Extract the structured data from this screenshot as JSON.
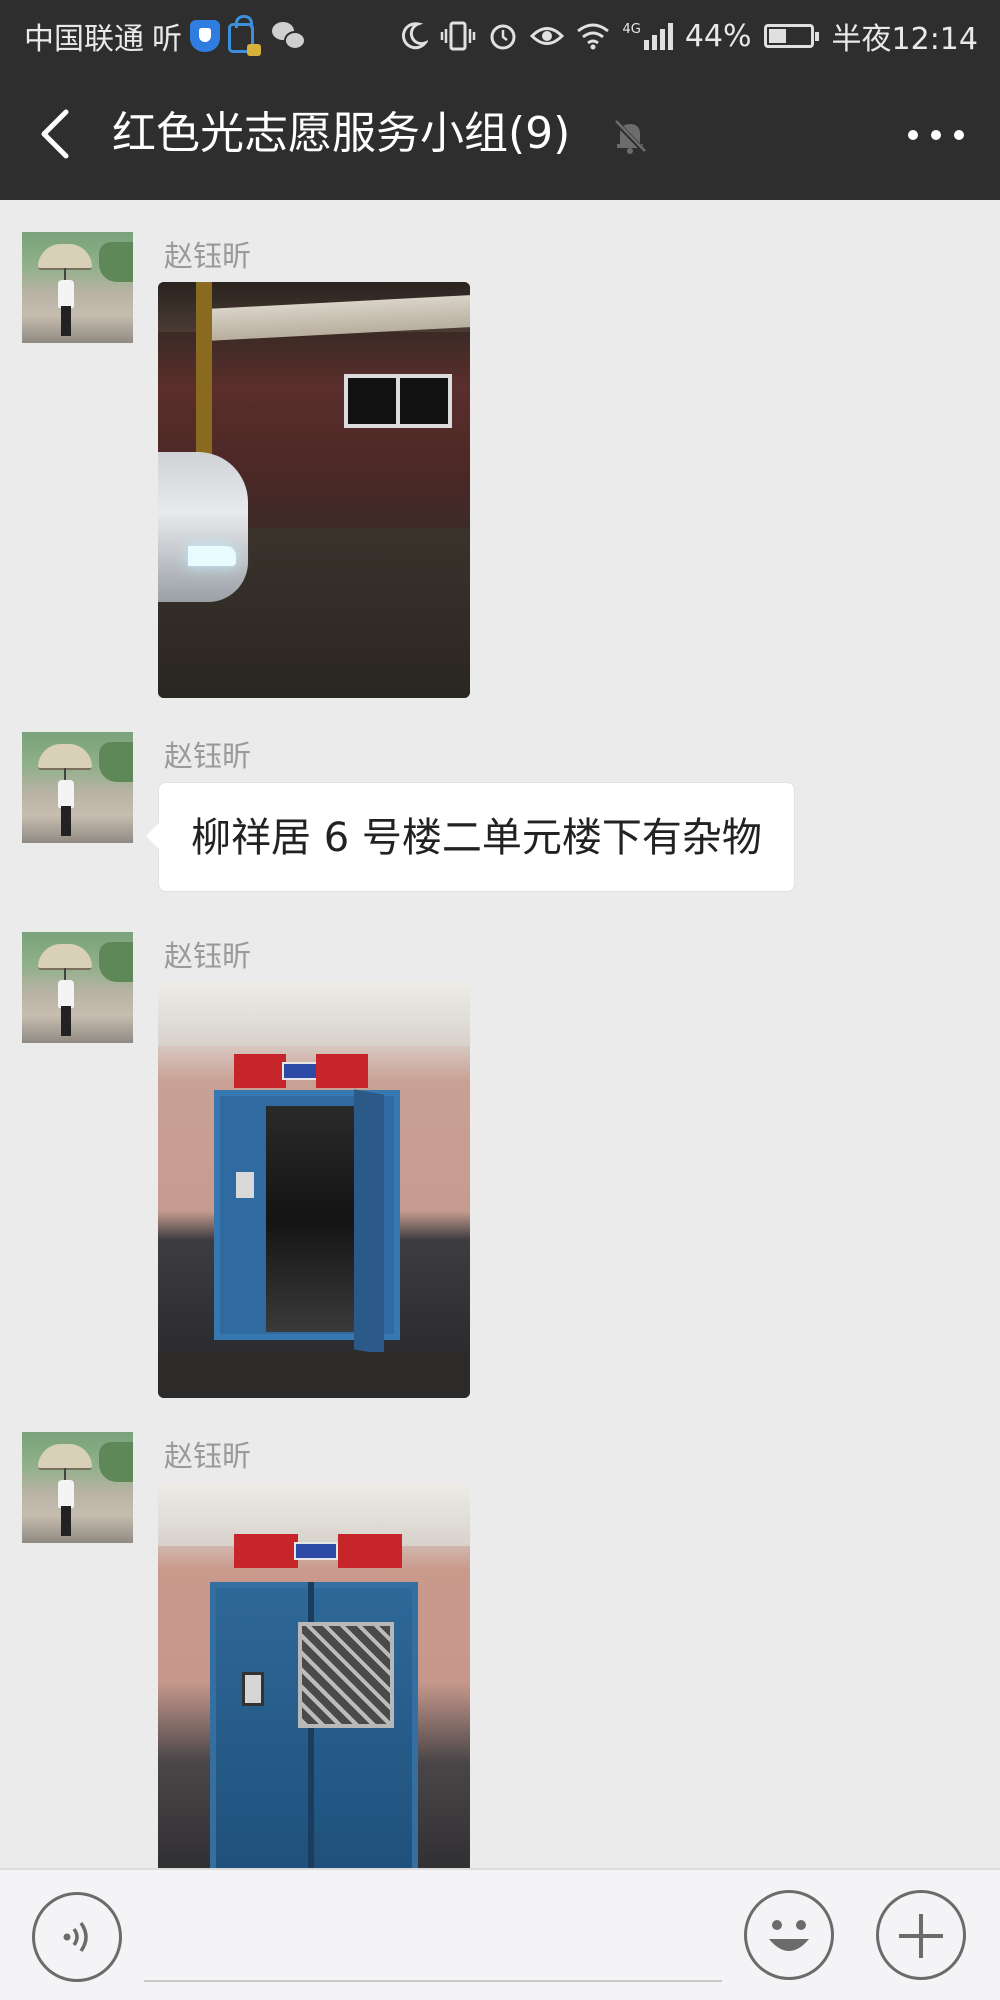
{
  "status_bar": {
    "carrier": "中国联通",
    "carrier_extra": "听",
    "network": "4G",
    "battery_percent": "44%",
    "battery_level": 0.44,
    "time": "半夜12:14",
    "icons": [
      "shield-icon",
      "bag-icon",
      "wechat-icon",
      "moon-icon",
      "vibrate-icon",
      "alarm-icon",
      "eye-icon",
      "wifi-icon",
      "signal-icon",
      "battery-icon"
    ]
  },
  "header": {
    "back_icon": "chevron-left-icon",
    "title": "红色光志愿服务小组(9)",
    "mute_icon": "bell-off-icon",
    "more_icon": "more-horizontal-icon"
  },
  "messages": [
    {
      "type": "image",
      "sender": "赵钰昕",
      "image": "photo-building-entrance-night"
    },
    {
      "type": "text",
      "sender": "赵钰昕",
      "text": "柳祥居 6 号楼二单元楼下有杂物"
    },
    {
      "type": "image",
      "sender": "赵钰昕",
      "image": "photo-open-blue-door"
    },
    {
      "type": "image",
      "sender": "赵钰昕",
      "image": "photo-closed-blue-door"
    }
  ],
  "input_bar": {
    "voice_icon": "voice-icon",
    "input_value": "",
    "emoji_icon": "smiley-icon",
    "plus_icon": "plus-icon"
  },
  "colors": {
    "header_bg": "#2e2e2e",
    "chat_bg": "#ebebeb",
    "bubble_bg": "#ffffff",
    "sender_name": "#9a9a9a"
  }
}
